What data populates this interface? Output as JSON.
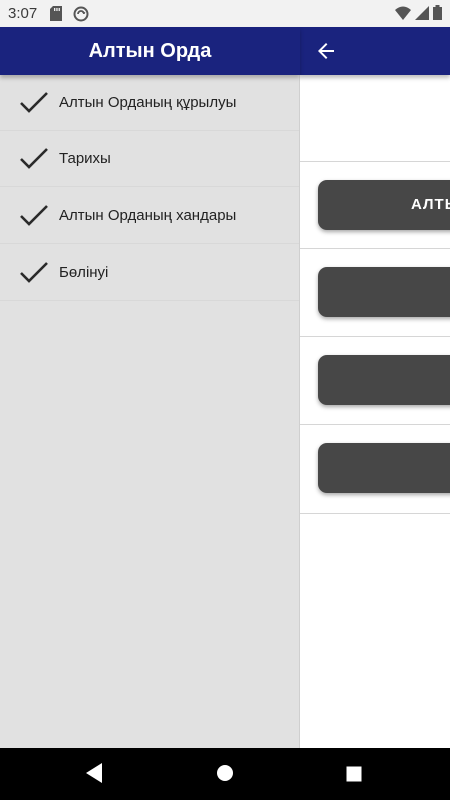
{
  "status_bar": {
    "time": "3:07",
    "left_icons": [
      "sd-card-icon",
      "sync-icon"
    ],
    "right_icons": [
      "wifi-icon",
      "signal-icon",
      "battery-icon"
    ]
  },
  "drawer": {
    "title": "Алтын Орда",
    "items": [
      {
        "icon": "check-icon",
        "label": "Алтын Орданың құрылуы"
      },
      {
        "icon": "check-icon",
        "label": "Тарихы"
      },
      {
        "icon": "check-icon",
        "label": "Алтын Орданың хандары"
      },
      {
        "icon": "check-icon",
        "label": "Бөлінуі"
      }
    ]
  },
  "content": {
    "back_icon": "back-arrow-icon",
    "buttons": [
      {
        "label": "АЛТЫ"
      },
      {
        "label": ""
      },
      {
        "label": ""
      },
      {
        "label": ""
      }
    ]
  },
  "nav_bar": {
    "icons": [
      "back-triangle-icon",
      "home-circle-icon",
      "recents-square-icon"
    ]
  },
  "colors": {
    "app_bar": "#1a237e",
    "drawer_bg": "#e1e1e1",
    "button_bg": "#474747"
  }
}
